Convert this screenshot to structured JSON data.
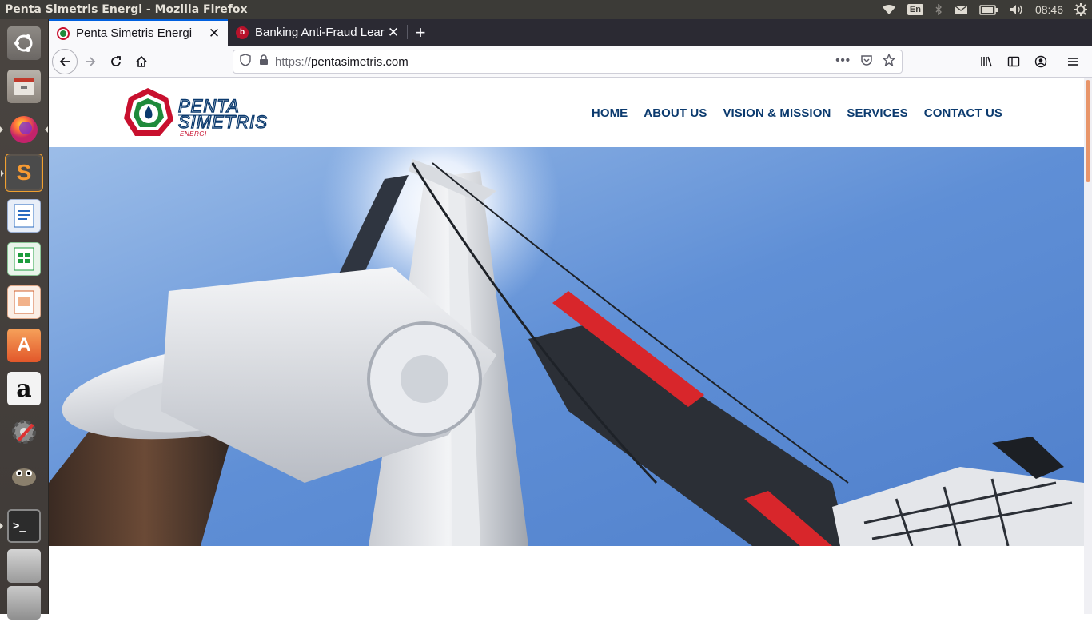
{
  "system": {
    "window_title": "Penta Simetris Energi - Mozilla Firefox",
    "keyboard_layout": "En",
    "clock": "08:46"
  },
  "launcher": {
    "items": [
      "ubuntu-dash-icon",
      "files-icon",
      "firefox-icon",
      "sublime-text-icon",
      "libreoffice-writer-icon",
      "libreoffice-calc-icon",
      "libreoffice-impress-icon",
      "ubuntu-software-icon",
      "amazon-icon",
      "system-settings-icon",
      "gimp-icon",
      "terminal-icon",
      "drive-icon",
      "trash-icon"
    ]
  },
  "browser": {
    "tabs": [
      {
        "title": "Penta Simetris Energi",
        "active": true
      },
      {
        "title": "Banking Anti-Fraud Lear",
        "active": false
      }
    ],
    "url_scheme": "https://",
    "url_host": "pentasimetris.com"
  },
  "site": {
    "logo": {
      "line1": "PENTA",
      "line2": "SIMETRIS",
      "line3": "ENERGI"
    },
    "nav": [
      "HOME",
      "ABOUT US",
      "VISION & MISSION",
      "SERVICES",
      "CONTACT US"
    ],
    "colors": {
      "nav": "#0b3a6e",
      "logo_red": "#c8102e",
      "logo_green": "#1f8a3b",
      "logo_blue": "#0b3a6e"
    }
  }
}
